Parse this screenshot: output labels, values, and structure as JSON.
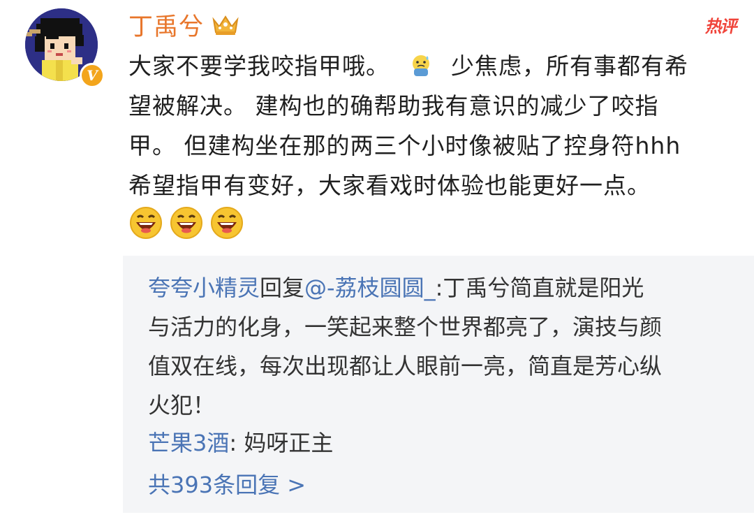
{
  "post": {
    "username": "丁禹兮",
    "hot_label": "热评",
    "badge_letter": "V",
    "avatar_icon": "pixel-character-avatar",
    "crown_icon": "crown-icon",
    "body_lines": {
      "line1_a": "大家不要学我咬指甲哦。",
      "line1_b": "少焦虑，所有事都有希",
      "line2": "望被解决。 建构也的确帮助我有意识的减少了咬指",
      "line3": "甲。 但建构坐在那的两三个小时像被贴了控身符hhh",
      "line4": "希望指甲有变好，大家看戏时体验也能更好一点。"
    },
    "emoji": {
      "inline": "worried-sweat-emoji",
      "trailing": [
        "laughing-emoji",
        "laughing-emoji",
        "laughing-emoji"
      ]
    }
  },
  "reply": {
    "author": "夸夸小精灵",
    "verb": "回复",
    "mention": "@-荔枝圆圆_",
    "line1_rest": ":丁禹兮简直就是阳光",
    "line2": "与活力的化身，一笑起来整个世界都亮了，演技与颜",
    "line3": "值双在线，每次出现都让人眼前一亮，简直是芳心纵",
    "line4": "火犯！",
    "sub_author": "芒果3酒",
    "sub_text": ": 妈呀正主",
    "more_label": "共393条回复 >"
  },
  "colors": {
    "username": "#e8762b",
    "link_blue": "#4a74b5",
    "hot_red": "#f0443a",
    "reply_bg": "#f4f5f7"
  }
}
